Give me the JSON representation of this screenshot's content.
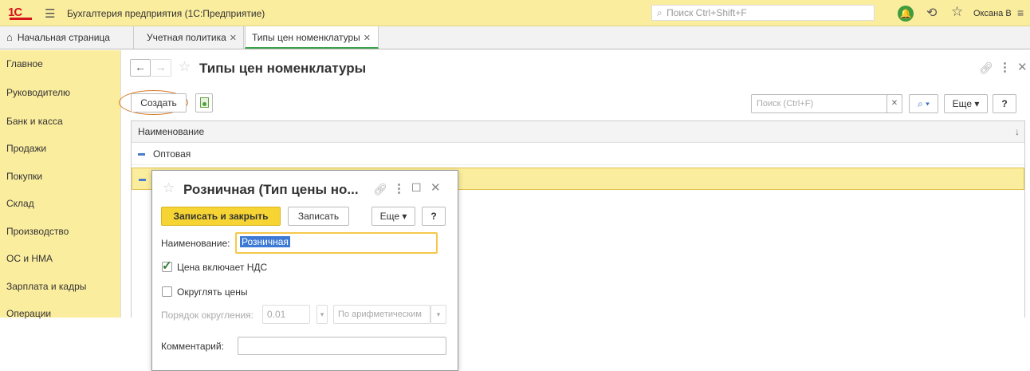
{
  "app": {
    "title": "Бухгалтерия предприятия  (1С:Предприятие)",
    "logo": "1С",
    "search_placeholder": "Поиск Ctrl+Shift+F",
    "user": "Оксана В"
  },
  "tabs": {
    "home": "Начальная страница",
    "items": [
      {
        "label": "Учетная политика"
      },
      {
        "label": "Типы цен номенклатуры"
      }
    ]
  },
  "sidebar": {
    "items": [
      {
        "label": "Главное"
      },
      {
        "label": "Руководителю"
      },
      {
        "label": "Банк и касса"
      },
      {
        "label": "Продажи"
      },
      {
        "label": "Покупки"
      },
      {
        "label": "Склад"
      },
      {
        "label": "Производство"
      },
      {
        "label": "ОС и НМА"
      },
      {
        "label": "Зарплата и кадры"
      },
      {
        "label": "Операции"
      }
    ]
  },
  "page": {
    "title": "Типы цен номенклатуры",
    "create_label": "Создать",
    "search_placeholder": "Поиск (Ctrl+F)",
    "more_label": "Еще",
    "help_label": "?",
    "column_header": "Наименование",
    "rows": [
      {
        "name": "Оптовая"
      },
      {
        "name": ""
      }
    ]
  },
  "modal": {
    "title": "Розничная (Тип цены но...",
    "save_close_label": "Записать и закрыть",
    "save_label": "Записать",
    "more_label": "Еще",
    "help_label": "?",
    "name_label": "Наименование:",
    "name_value": "Розничная",
    "vat_label": "Цена включает НДС",
    "vat_checked": true,
    "round_label": "Округлять цены",
    "round_checked": false,
    "round_order_label": "Порядок округления:",
    "round_order_value": "0.01",
    "round_method_value": "По арифметическим",
    "comment_label": "Комментарий:"
  },
  "colors": {
    "accent_yellow": "#fbed9e",
    "primary_button": "#f6d433",
    "active_tab_border": "#3aa34a",
    "highlight_ring": "#d87a28"
  }
}
